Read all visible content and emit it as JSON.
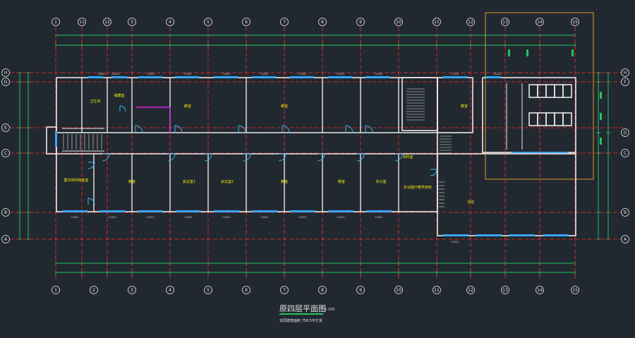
{
  "drawing": {
    "title": "原四层平面图",
    "scale": "1:100",
    "subtitle": "本层建筑面积 758.5平方米"
  },
  "axes": {
    "columns": [
      "1",
      "11",
      "12",
      "3",
      "4",
      "5",
      "6",
      "7",
      "8",
      "9",
      "10",
      "11",
      "12",
      "13",
      "14",
      "15"
    ],
    "columns_bottom": [
      "1",
      "2",
      "3",
      "4",
      "5",
      "6",
      "7",
      "8",
      "9",
      "10",
      "11",
      "12",
      "13",
      "14",
      "15"
    ],
    "rows_left": [
      "H",
      "G",
      "E",
      "C",
      "B",
      "A"
    ],
    "rows_right": [
      "H",
      "F",
      "D",
      "C",
      "B",
      "A"
    ]
  },
  "rooms": [
    {
      "id": "r1",
      "label": "卫生间"
    },
    {
      "id": "r2",
      "label": "储藏室"
    },
    {
      "id": "r3",
      "label": "教室"
    },
    {
      "id": "r4",
      "label": "教室"
    },
    {
      "id": "r5",
      "label": "教室"
    },
    {
      "id": "r6",
      "label": "图书资料档案室"
    },
    {
      "id": "r7",
      "label": "教室"
    },
    {
      "id": "r8",
      "label": "会议室1"
    },
    {
      "id": "r9",
      "label": "会议室2"
    },
    {
      "id": "r10",
      "label": "教室"
    },
    {
      "id": "r11",
      "label": "教室"
    },
    {
      "id": "r12",
      "label": "办公室"
    },
    {
      "id": "r13",
      "label": "资料室"
    },
    {
      "id": "r14",
      "label": "多功能厅教学用房"
    },
    {
      "id": "r15",
      "label": "活动"
    }
  ],
  "window_labels": [
    "C2421",
    "C2421",
    "C2421",
    "C2421",
    "C2421",
    "C2421",
    "C2421",
    "C2421",
    "C2421",
    "C1521",
    "C1521",
    "C2421",
    "C2421",
    "C2421",
    "C2421",
    "C2421",
    "C2421",
    "C2421",
    "C2421",
    "C2421",
    "C2421"
  ],
  "colors": {
    "background": "#212830",
    "wall": "#e8e8e8",
    "axis": "#ff2a2a",
    "dimension": "#22c55e",
    "window": "#38a5f5",
    "door": "#38b7f5",
    "label": "#f5e90b",
    "highlight_frame": "#d99a2b",
    "magenta": "#e020e0"
  }
}
